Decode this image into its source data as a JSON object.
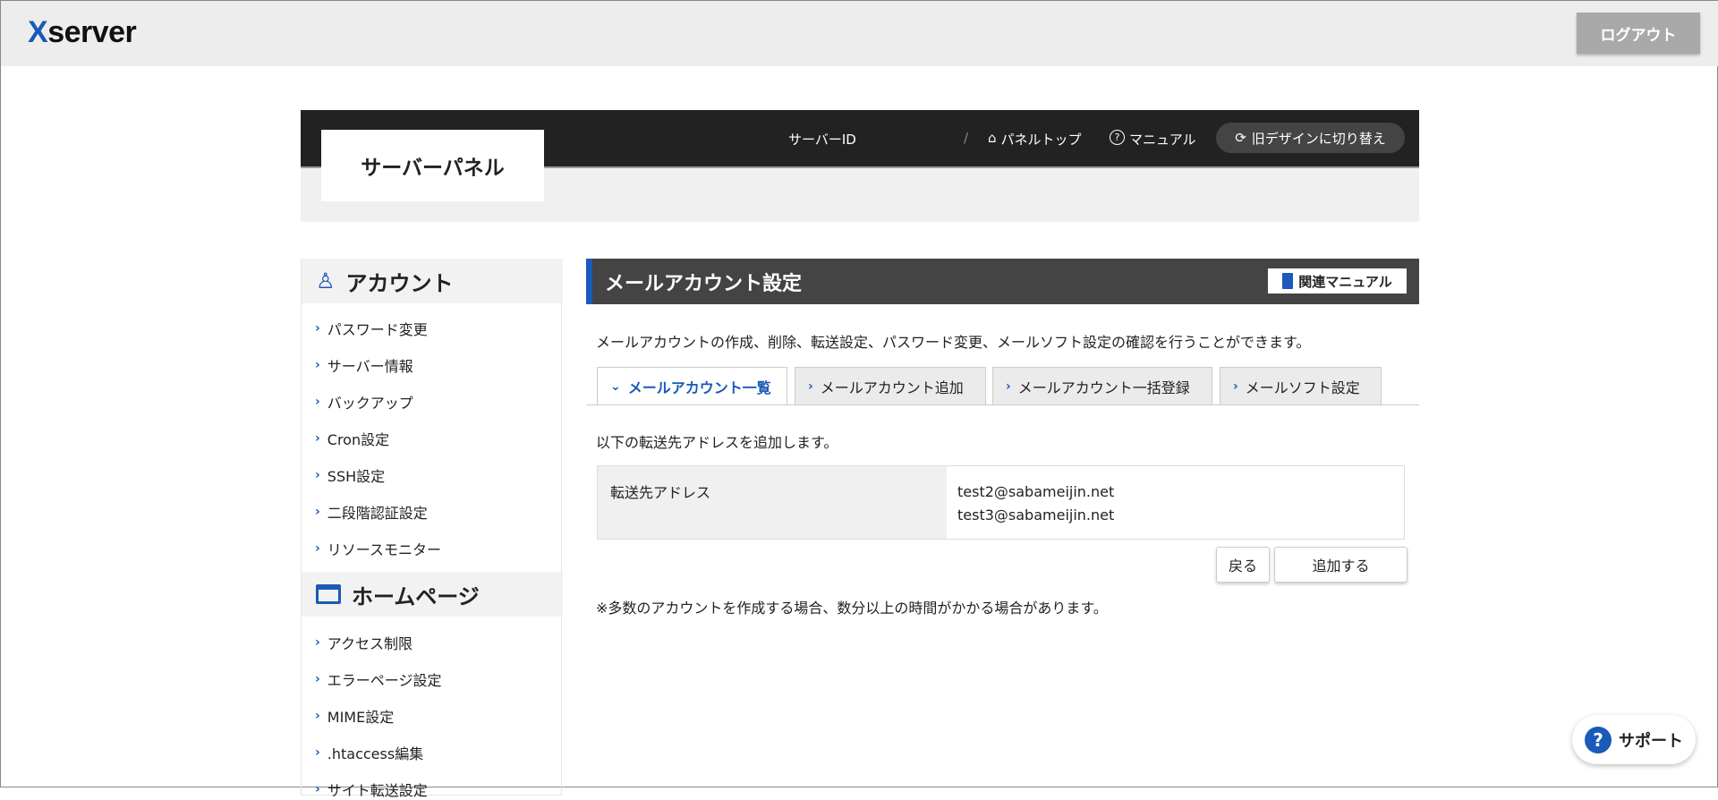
{
  "header": {
    "logo_prefix": "X",
    "logo_rest": "server",
    "logout": "ログアウト"
  },
  "panel": {
    "title": "サーバーパネル",
    "server_id_label": "サーバーID",
    "separator": "/",
    "panel_top": "パネルトップ",
    "manual": "マニュアル",
    "old_design": "旧デザインに切り替え"
  },
  "sidebar": {
    "account": {
      "title": "アカウント",
      "items": [
        "パスワード変更",
        "サーバー情報",
        "バックアップ",
        "Cron設定",
        "SSH設定",
        "二段階認証設定",
        "リソースモニター"
      ]
    },
    "homepage": {
      "title": "ホームページ",
      "items": [
        "アクセス制限",
        "エラーページ設定",
        "MIME設定",
        ".htaccess編集",
        "サイト転送設定"
      ]
    }
  },
  "main": {
    "title": "メールアカウント設定",
    "related_manual": "関連マニュアル",
    "description": "メールアカウントの作成、削除、転送設定、パスワード変更、メールソフト設定の確認を行うことができます。",
    "tabs": [
      "メールアカウント一覧",
      "メールアカウント追加",
      "メールアカウント一括登録",
      "メールソフト設定"
    ],
    "intro": "以下の転送先アドレスを追加します。",
    "table": {
      "label": "転送先アドレス",
      "values": [
        "test2@sabameijin.net",
        "test3@sabameijin.net"
      ]
    },
    "back": "戻る",
    "add": "追加する",
    "note": "※多数のアカウントを作成する場合、数分以上の時間がかかる場合があります。"
  },
  "support": "サポート"
}
